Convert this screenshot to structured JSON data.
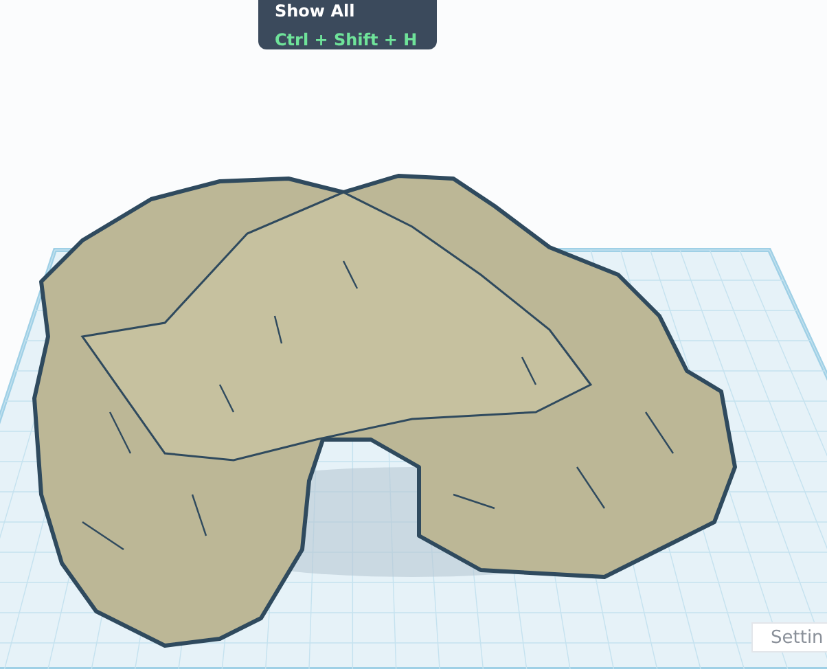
{
  "tooltip": {
    "title": "Show All",
    "shortcut": "Ctrl + Shift + H"
  },
  "settings_button": {
    "label": "Settin"
  }
}
